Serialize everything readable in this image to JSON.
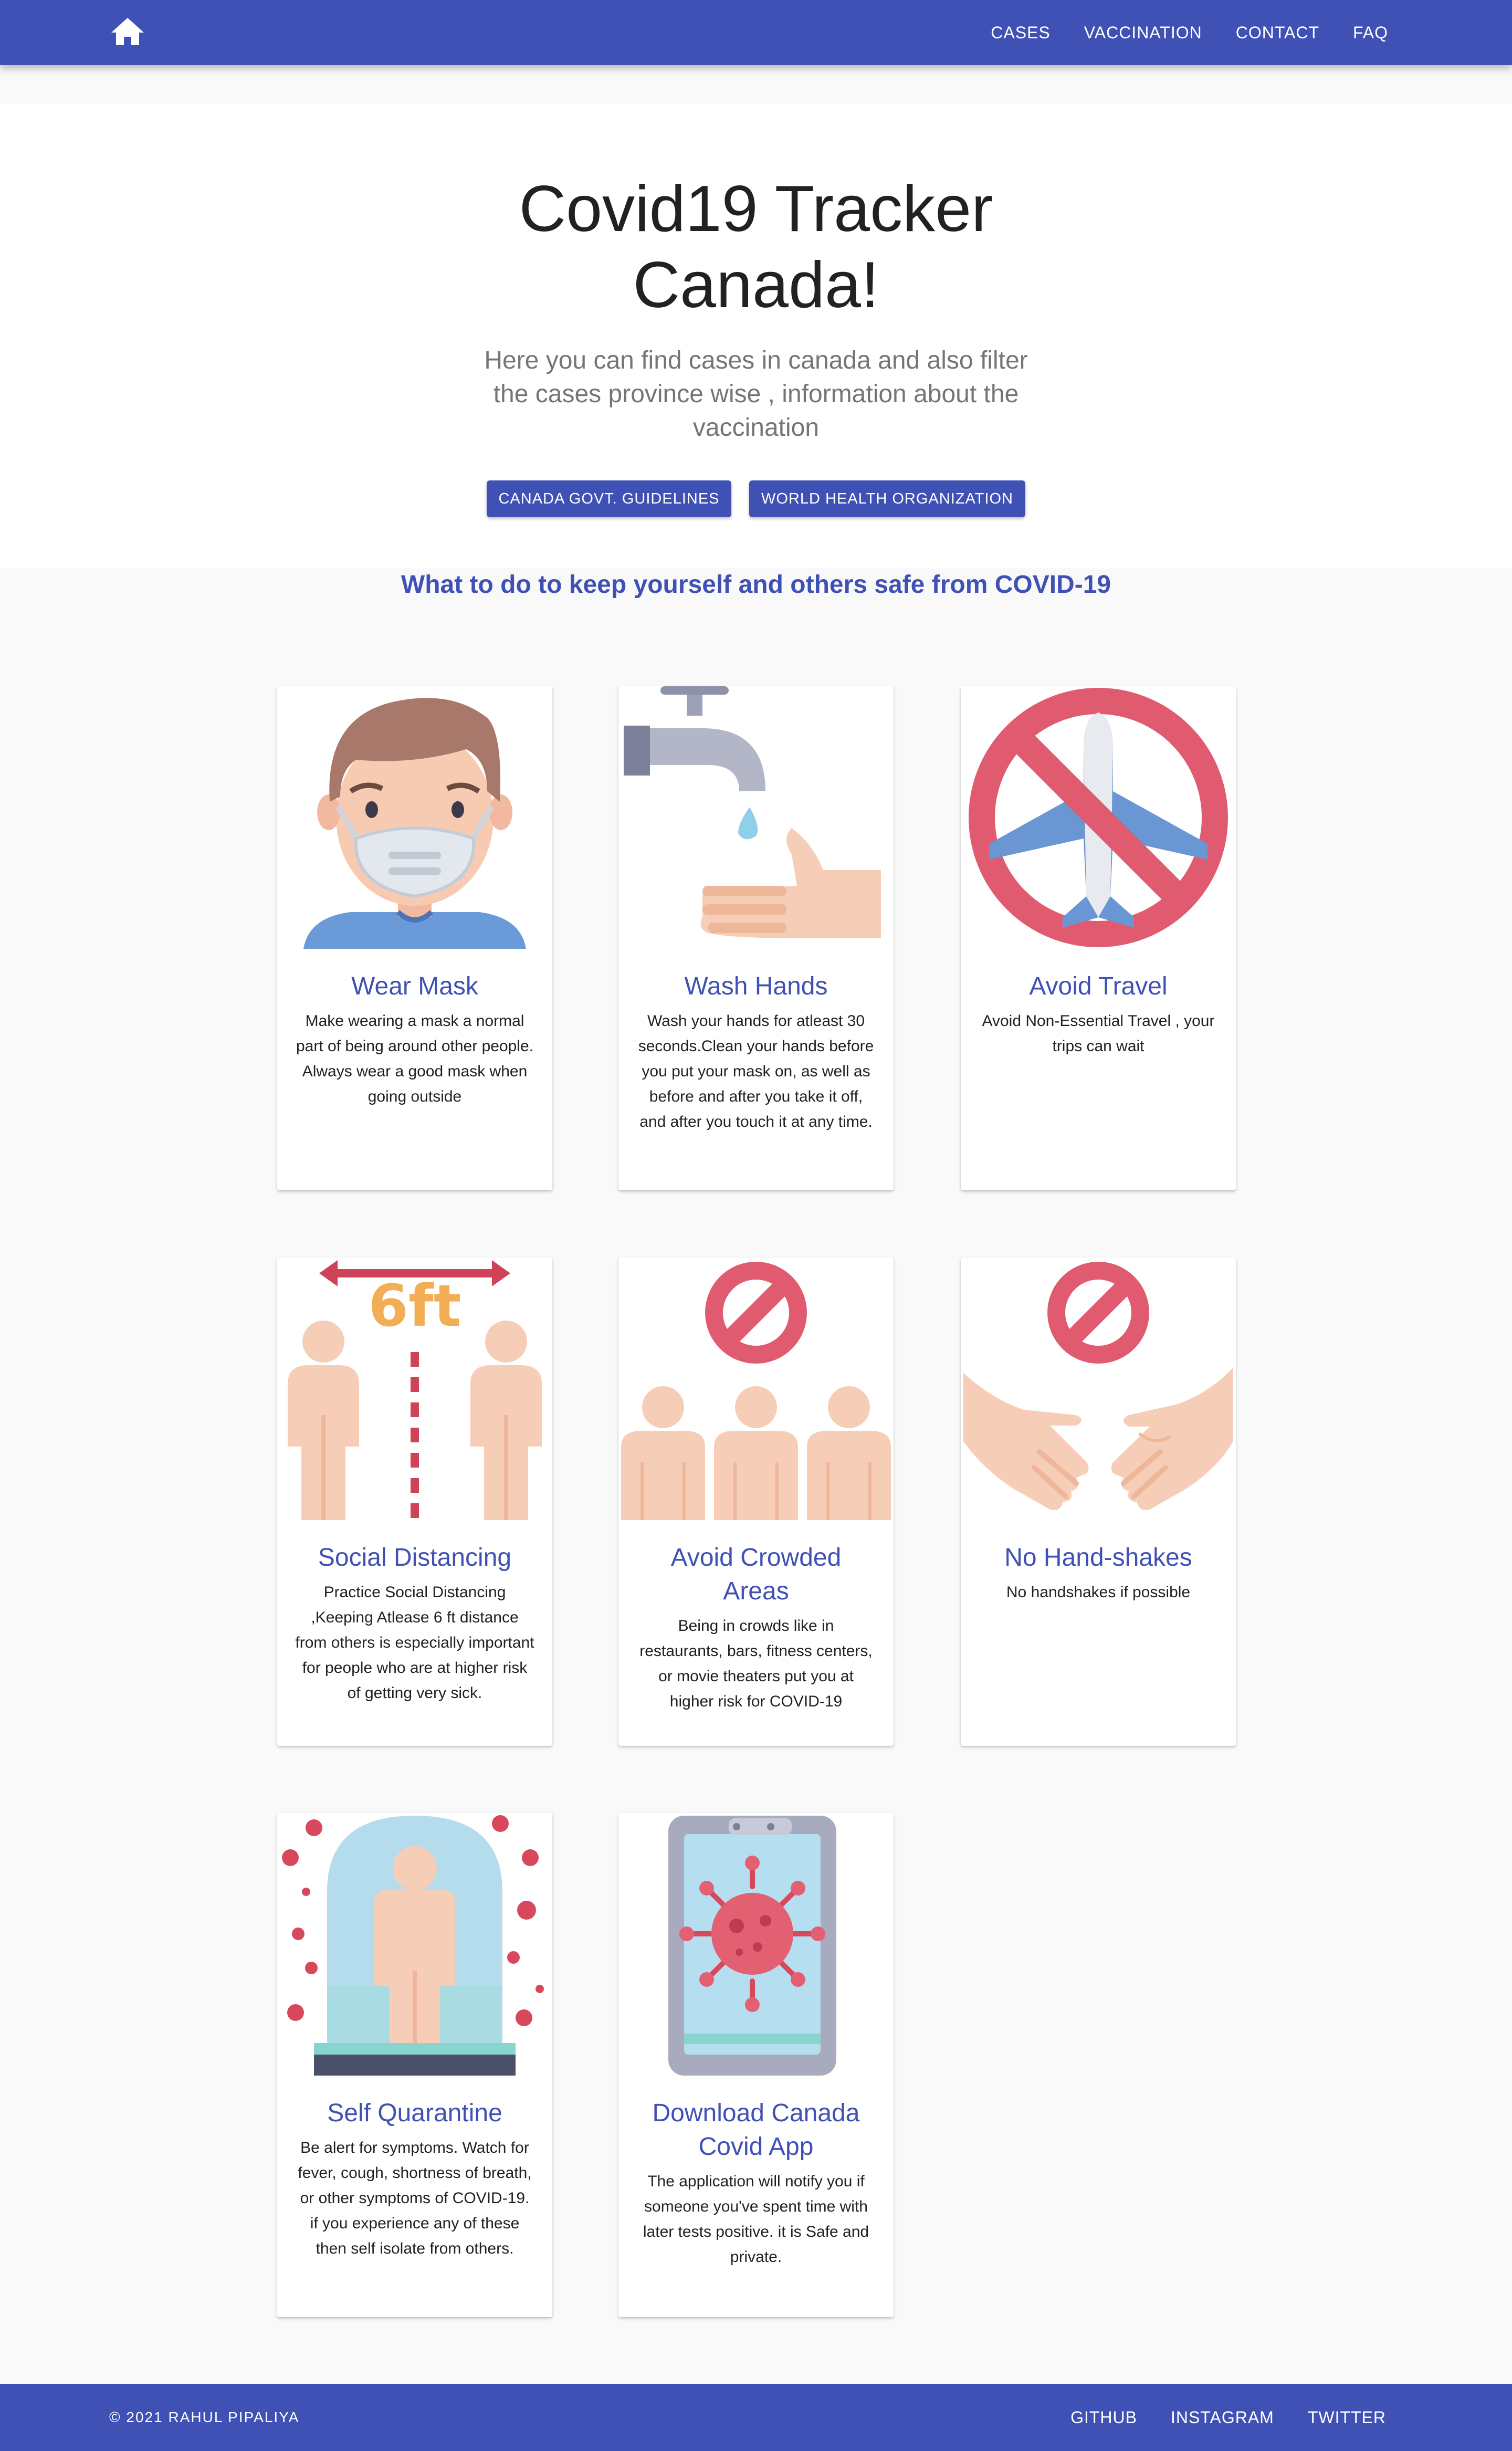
{
  "nav": {
    "home_icon": "home-icon",
    "links": [
      "CASES",
      "VACCINATION",
      "CONTACT",
      "FAQ"
    ]
  },
  "hero": {
    "title_line1": "Covid19 Tracker",
    "title_line2": "Canada!",
    "subtitle": "Here you can find cases in canada and also filter the cases province wise , information about the vaccination",
    "buttons": [
      "CANADA GOVT. GUIDELINES",
      "WORLD HEALTH ORGANIZATION"
    ]
  },
  "safety": {
    "heading": "What to do to keep yourself and others safe from COVID-19",
    "cards": [
      {
        "icon": "face-mask-icon",
        "title": "Wear Mask",
        "text": "Make wearing a mask a normal part of being around other people. Always wear a good mask when going outside"
      },
      {
        "icon": "wash-hands-icon",
        "title": "Wash Hands",
        "text": "Wash your hands for atleast 30 seconds.Clean your hands before you put your mask on, as well as before and after you take it off, and after you touch it at any time."
      },
      {
        "icon": "no-travel-icon",
        "title": "Avoid Travel",
        "text": "Avoid Non-Essential Travel , your trips can wait"
      },
      {
        "icon": "social-distancing-icon",
        "title": "Social Distancing",
        "text": "Practice Social Distancing ,Keeping Atlease 6 ft distance from others is especially important for people who are at higher risk of getting very sick."
      },
      {
        "icon": "no-crowd-icon",
        "title": "Avoid Crowded Areas",
        "text": "Being in crowds like in restaurants, bars, fitness centers, or movie theaters put you at higher risk for COVID-19"
      },
      {
        "icon": "no-handshake-icon",
        "title": "No Hand-shakes",
        "text": "No handshakes if possible"
      },
      {
        "icon": "quarantine-icon",
        "title": "Self Quarantine",
        "text": "Be alert for symptoms. Watch for fever, cough, shortness of breath, or other symptoms of COVID-19. if you experience any of these then self isolate from others."
      },
      {
        "icon": "covid-app-icon",
        "title": "Download Canada Covid App",
        "text": "The application will notify you if someone you've spent time with later tests positive. it is Safe and private."
      }
    ],
    "distance_label": "6ft"
  },
  "footer": {
    "copyright": "© 2021 RAHUL PIPALIYA",
    "links": [
      "GITHUB",
      "INSTAGRAM",
      "TWITTER"
    ]
  },
  "colors": {
    "primary": "#3f51b5",
    "background": "#f9f9f9",
    "red": "#d8485c",
    "skin": "#f5c4a6"
  }
}
